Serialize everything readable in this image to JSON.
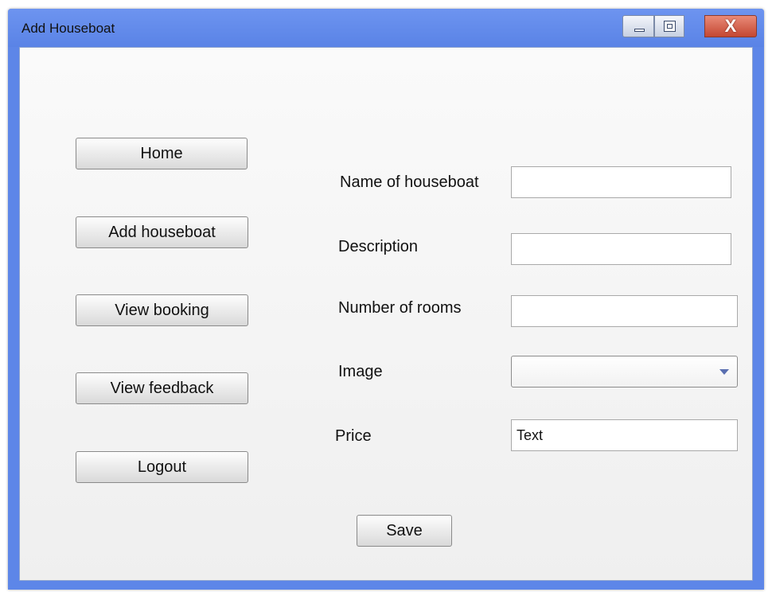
{
  "window": {
    "title": "Add Houseboat",
    "controls": {
      "minimize_icon": "minimize-icon",
      "maximize_icon": "maximize-icon",
      "close_label": "X"
    },
    "titlebar_color": "#5d86e8",
    "close_color": "#c44732"
  },
  "nav": {
    "items": [
      {
        "label": "Home"
      },
      {
        "label": "Add houseboat"
      },
      {
        "label": "View booking"
      },
      {
        "label": "View feedback"
      },
      {
        "label": "Logout"
      }
    ]
  },
  "form": {
    "fields": [
      {
        "label": "Name of houseboat",
        "value": ""
      },
      {
        "label": "Description",
        "value": ""
      },
      {
        "label": "Number of rooms",
        "value": ""
      },
      {
        "label": "Image",
        "value": "",
        "type": "select"
      },
      {
        "label": "Price",
        "value": "Text"
      }
    ],
    "save_label": "Save"
  }
}
